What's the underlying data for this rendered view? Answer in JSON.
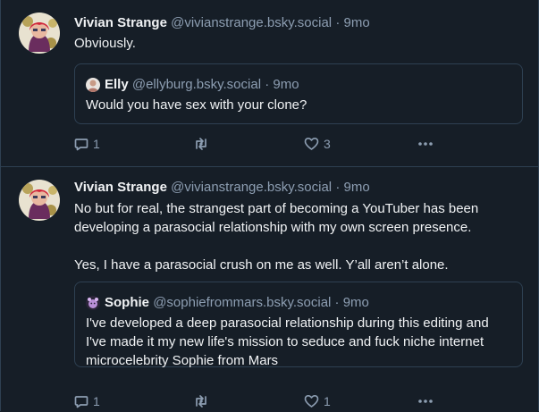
{
  "posts": [
    {
      "author": "Vivian Strange",
      "handle": "@vivianstrange.bsky.social",
      "separator": "·",
      "time": "9mo",
      "text": [
        "Obviously."
      ],
      "quote": {
        "author": "Elly",
        "handle": "@ellyburg.bsky.social",
        "separator": "·",
        "time": "9mo",
        "text": "Would you have sex with your clone?"
      },
      "actions": {
        "replies": "1",
        "reposts": "",
        "likes": "3"
      }
    },
    {
      "author": "Vivian Strange",
      "handle": "@vivianstrange.bsky.social",
      "separator": "·",
      "time": "9mo",
      "text": [
        "No but for real, the strangest part of becoming a YouTuber has been developing a parasocial relationship with my own screen presence.",
        "Yes, I have a parasocial crush on me as well. Y’all aren’t alone."
      ],
      "quote": {
        "author": "Sophie",
        "handle": "@sophiefrommars.bsky.social",
        "separator": "·",
        "time": "9mo",
        "text": "I've developed a deep parasocial relationship during this editing and I've made it my new life's mission to seduce and fuck niche internet microcelebrity Sophie from Mars"
      },
      "actions": {
        "replies": "1",
        "reposts": "",
        "likes": "1"
      }
    }
  ],
  "colors": {
    "background": "#161e27",
    "border": "#2e4052",
    "text": "#f1f3f5",
    "muted": "#8d9eb2"
  },
  "icons": [
    "reply-icon",
    "repost-icon",
    "like-icon",
    "more-icon"
  ]
}
